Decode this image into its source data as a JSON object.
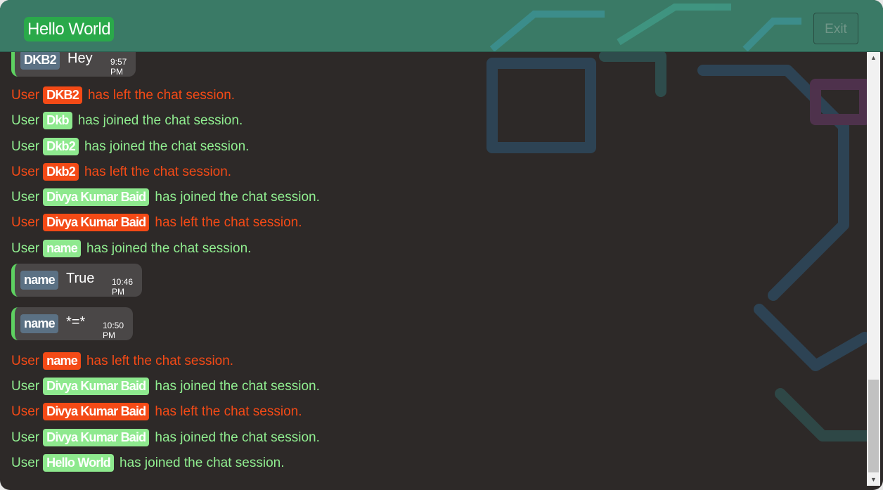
{
  "header": {
    "brand": "Hello World",
    "exit_label": "Exit"
  },
  "messages": [
    {
      "kind": "chat",
      "user": "DKB2",
      "text": "Hey",
      "time": "9:57 PM"
    },
    {
      "kind": "leave",
      "prefix": "User",
      "user": "DKB2",
      "suffix": "has left the chat session."
    },
    {
      "kind": "join",
      "prefix": "User",
      "user": "Dkb",
      "suffix": "has joined the chat session."
    },
    {
      "kind": "join",
      "prefix": "User",
      "user": "Dkb2",
      "suffix": "has joined the chat session."
    },
    {
      "kind": "leave",
      "prefix": "User",
      "user": "Dkb2",
      "suffix": "has left the chat session."
    },
    {
      "kind": "join",
      "prefix": "User",
      "user": "Divya Kumar Baid",
      "suffix": "has joined the chat session."
    },
    {
      "kind": "leave",
      "prefix": "User",
      "user": "Divya Kumar Baid",
      "suffix": "has left the chat session."
    },
    {
      "kind": "join",
      "prefix": "User",
      "user": "name",
      "suffix": "has joined the chat session."
    },
    {
      "kind": "chat",
      "user": "name",
      "text": "True",
      "time": "10:46 PM"
    },
    {
      "kind": "chat",
      "user": "name",
      "text": "*=*",
      "time": "10:50 PM"
    },
    {
      "kind": "leave",
      "prefix": "User",
      "user": "name",
      "suffix": "has left the chat session."
    },
    {
      "kind": "join",
      "prefix": "User",
      "user": "Divya Kumar Baid",
      "suffix": "has joined the chat session."
    },
    {
      "kind": "leave",
      "prefix": "User",
      "user": "Divya Kumar Baid",
      "suffix": "has left the chat session."
    },
    {
      "kind": "join",
      "prefix": "User",
      "user": "Divya Kumar Baid",
      "suffix": "has joined the chat session."
    },
    {
      "kind": "join",
      "prefix": "User",
      "user": "Hello World",
      "suffix": "has joined the chat session."
    }
  ],
  "colors": {
    "header_bg": "#3a7a66",
    "brand_bg": "#2aa94a",
    "join": "#90ee90",
    "leave": "#f44a16",
    "bubble_bg": "#4a4747",
    "bubble_accent": "#5ed161",
    "user_chip": "#5b7184"
  },
  "icons": {
    "scroll_up": "▲",
    "scroll_down": "▼"
  }
}
